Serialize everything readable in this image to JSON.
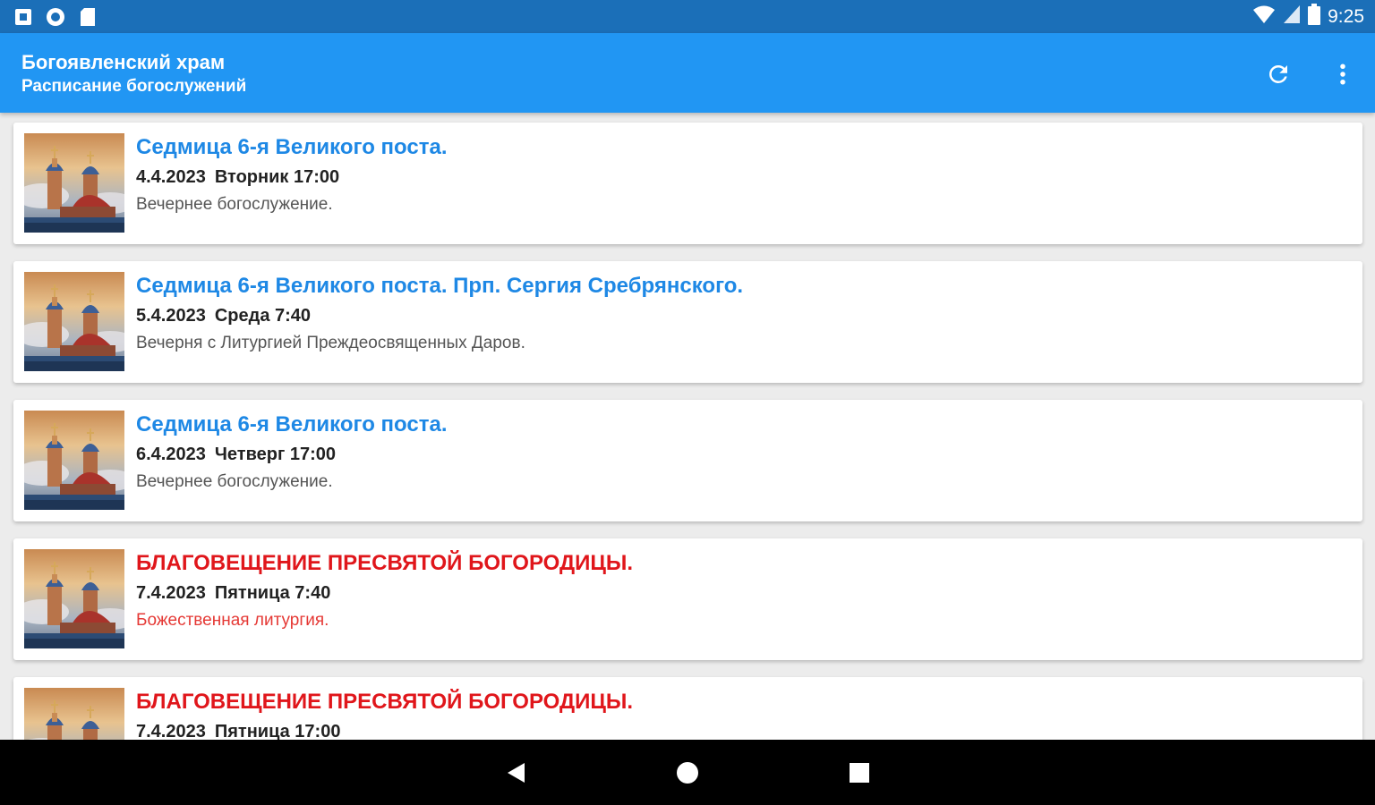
{
  "status_bar": {
    "time": "9:25",
    "icons_left": [
      "notification-square-icon",
      "sync-circle-icon",
      "sd-card-icon"
    ],
    "icons_right": [
      "wifi-icon",
      "signal-icon",
      "battery-icon"
    ]
  },
  "app_bar": {
    "title": "Богоявленский храм",
    "subtitle": "Расписание богослужений",
    "actions": [
      "refresh-icon",
      "more-vert-icon"
    ]
  },
  "colors": {
    "status_bar": "#1b6fb8",
    "app_bar": "#2196f3",
    "title_normal": "#1e88e5",
    "title_feast": "#e0161b"
  },
  "services": [
    {
      "title": "Седмица 6-я Великого поста.",
      "date": "4.4.2023",
      "weekday_time": "Вторник 17:00",
      "description": "Вечернее богослужение.",
      "feast": false
    },
    {
      "title": "Седмица 6-я Великого поста. Прп. Сергия Сребрянского.",
      "date": "5.4.2023",
      "weekday_time": "Среда 7:40",
      "description": "Вечерня с Литургией Преждеосвященных Даров.",
      "feast": false
    },
    {
      "title": "Седмица 6-я Великого поста.",
      "date": "6.4.2023",
      "weekday_time": "Четверг 17:00",
      "description": "Вечернее богослужение.",
      "feast": false
    },
    {
      "title": "БЛАГОВЕЩЕНИЕ ПРЕСВЯТОЙ БОГОРОДИЦЫ.",
      "date": "7.4.2023",
      "weekday_time": "Пятница 7:40",
      "description": "Божественная литургия.",
      "feast": true
    },
    {
      "title": "БЛАГОВЕЩЕНИЕ ПРЕСВЯТОЙ БОГОРОДИЦЫ.",
      "date": "7.4.2023",
      "weekday_time": "Пятница 17:00",
      "description": "",
      "feast": true
    }
  ],
  "nav_bar": {
    "buttons": [
      "back-icon",
      "home-icon",
      "recents-icon"
    ]
  }
}
